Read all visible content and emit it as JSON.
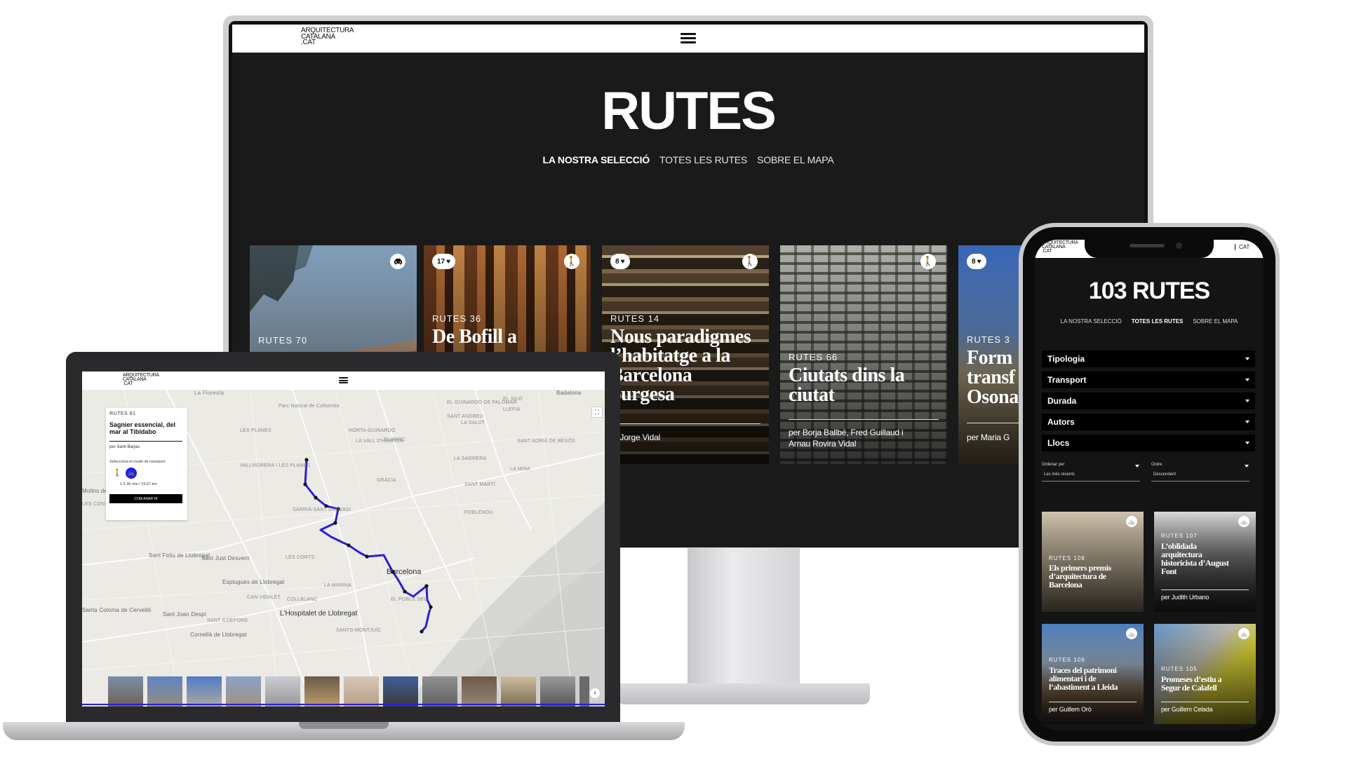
{
  "brand": {
    "logo_lines": [
      "ARQUITECTURA",
      "CATALANA",
      ".CAT"
    ]
  },
  "desktop": {
    "title": "RUTES",
    "tabs": [
      "LA NOSTRA SELECCIÓ",
      "TOTES LES RUTES",
      "SOBRE EL MAPA"
    ],
    "active_tab": "LA NOSTRA SELECCIÓ",
    "cards": [
      {
        "num": "RUTES 70",
        "title": "",
        "author": "",
        "likes": "",
        "mode_icon": "car-icon"
      },
      {
        "num": "RUTES 36",
        "title": "De Bofill a",
        "author": "",
        "likes": "17",
        "mode_icon": "walk-icon"
      },
      {
        "num": "RUTES 14",
        "title_lines": [
          "Nous paradigmes",
          "l’habitatge a la",
          "Barcelona",
          "burgesa"
        ],
        "author": "er Jorge Vidal",
        "likes": "8",
        "mode_icon": "walk-icon"
      },
      {
        "num": "RUTES 66",
        "title_lines": [
          "Ciutats dins la",
          "ciutat"
        ],
        "author_lines": [
          "per Borja Ballbé, Fred Guillaud i",
          "Arnau Rovira Vidal"
        ],
        "likes": "",
        "mode_icon": "walk-icon"
      },
      {
        "num": "RUTES 3",
        "title_lines": [
          "Form",
          "transf",
          "Osona"
        ],
        "author": "per Maria G",
        "likes": "8",
        "mode_icon": ""
      }
    ]
  },
  "laptop": {
    "panel": {
      "num": "RUTES 61",
      "title_lines": [
        "Sagnier essencial, del",
        "mar al Tibidabo"
      ],
      "author": "per Santi Barjau",
      "mode_prompt": "Selecciona el mode de transport:",
      "duration": "1 h 36 min / 15.67 km",
      "button": "COM ANAR-HI"
    },
    "map_labels": [
      "La Floresta",
      "Parc Natural de Collserola",
      "EL GUINARDÓ DE PALOMAR",
      "EL SILÓ",
      "LLEFIÀ",
      "SANT ANDREU",
      "LA SALUT",
      "LES PLANES",
      "HORTA-GUINARDÓ",
      "LA VALL D'HEBRON",
      "EL PARC",
      "SANT ADRIÀ DE BESÒS",
      "VALLVIDRERA I LES PLANES",
      "LA SAGRERA",
      "GRÀCIA",
      "SANT MARTÍ",
      "LA MINA",
      "LES CONSERVES",
      "SARRIÀ-SANT GERVASI",
      "POBLENOU",
      "LES CORTS",
      "Barcelona",
      "Sant Feliu de Llobregat",
      "Sant Just Desvern",
      "Esplugues de Llobregat",
      "CAN VIDALET",
      "COLLBLANC",
      "LA MARINA",
      "EL POBLE SEC",
      "L'Hospitalet de Llobregat",
      "Santa Coloma de Cervelló",
      "Sant Joan Despí",
      "SANT ILDEFONS",
      "Cornellà de Llobregat",
      "SANTS-MONTJUÏC",
      "Badalona",
      "Molins de R"
    ]
  },
  "phone": {
    "lang": "CAT",
    "title": "103 RUTES",
    "tabs": [
      "LA NOSTRA SELECCIÓ",
      "TOTES LES RUTES",
      "SOBRE EL MAPA"
    ],
    "active_tab": "TOTES LES RUTES",
    "filters": [
      "Tipologia",
      "Transport",
      "Durada",
      "Autors",
      "Llocs"
    ],
    "sort": {
      "order_by_label": "Ordenar per",
      "order_by_value": "Les més recents",
      "order_label": "Ordre",
      "order_value": "Descendent"
    },
    "cards": [
      {
        "num": "RUTES 108",
        "title_lines": [
          "Els primers premis",
          "d’arquitectura de",
          "Barcelona"
        ],
        "author": "",
        "mode_icon": "bike-icon"
      },
      {
        "num": "RUTES 107",
        "title_lines": [
          "L’oblidada",
          "arquitectura",
          "historicista d’August",
          "Font"
        ],
        "author": "per Judith Urbano",
        "mode_icon": "bike-icon"
      },
      {
        "num": "RUTES 106",
        "title_lines": [
          "Traces del patrimoni",
          "alimentari i de",
          "l’abastiment a Lleida"
        ],
        "author": "per Guillem Orò",
        "mode_icon": "bike-icon"
      },
      {
        "num": "RUTES 105",
        "title_lines": [
          "Promeses d’estiu a",
          "Segur de Calafell"
        ],
        "author": "per Guillem Celada",
        "mode_icon": "bike-icon"
      }
    ]
  }
}
